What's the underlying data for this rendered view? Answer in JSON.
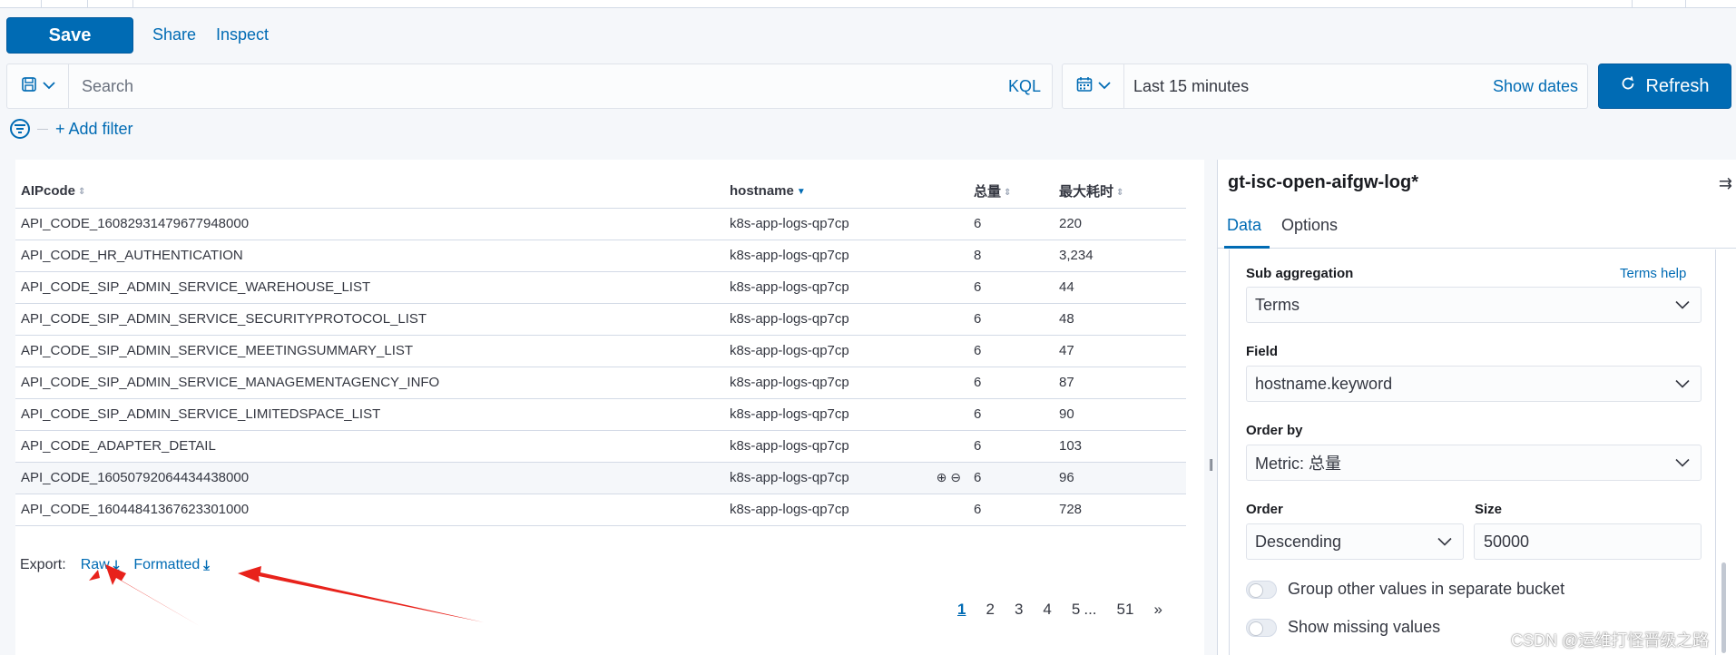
{
  "toolbar": {
    "save_label": "Save",
    "share_label": "Share",
    "inspect_label": "Inspect"
  },
  "query": {
    "placeholder": "Search",
    "language": "KQL"
  },
  "time": {
    "range": "Last 15 minutes",
    "show_dates_label": "Show dates",
    "refresh_label": "Refresh"
  },
  "filter": {
    "add_label": "+ Add filter"
  },
  "table": {
    "columns": [
      "AIPcode",
      "hostname",
      "总量",
      "最大耗时"
    ],
    "rows": [
      [
        "API_CODE_16082931479677948000",
        "k8s-app-logs-qp7cp",
        "6",
        "220"
      ],
      [
        "API_CODE_HR_AUTHENTICATION",
        "k8s-app-logs-qp7cp",
        "8",
        "3,234"
      ],
      [
        "API_CODE_SIP_ADMIN_SERVICE_WAREHOUSE_LIST",
        "k8s-app-logs-qp7cp",
        "6",
        "44"
      ],
      [
        "API_CODE_SIP_ADMIN_SERVICE_SECURITYPROTOCOL_LIST",
        "k8s-app-logs-qp7cp",
        "6",
        "48"
      ],
      [
        "API_CODE_SIP_ADMIN_SERVICE_MEETINGSUMMARY_LIST",
        "k8s-app-logs-qp7cp",
        "6",
        "47"
      ],
      [
        "API_CODE_SIP_ADMIN_SERVICE_MANAGEMENTAGENCY_INFO",
        "k8s-app-logs-qp7cp",
        "6",
        "87"
      ],
      [
        "API_CODE_SIP_ADMIN_SERVICE_LIMITEDSPACE_LIST",
        "k8s-app-logs-qp7cp",
        "6",
        "90"
      ],
      [
        "API_CODE_ADAPTER_DETAIL",
        "k8s-app-logs-qp7cp",
        "6",
        "103"
      ],
      [
        "API_CODE_16050792064434438000",
        "k8s-app-logs-qp7cp",
        "6",
        "96"
      ],
      [
        "API_CODE_16044841367623301000",
        "k8s-app-logs-qp7cp",
        "6",
        "728"
      ]
    ]
  },
  "export": {
    "label": "Export:",
    "raw_label": "Raw",
    "formatted_label": "Formatted"
  },
  "pagination": {
    "pages": [
      "1",
      "2",
      "3",
      "4",
      "5"
    ],
    "ellipsis": "...",
    "last": "51",
    "next": "»",
    "current": "1"
  },
  "sidebar": {
    "index_pattern": "gt-isc-open-aifgw-log*",
    "tabs": [
      "Data",
      "Options"
    ],
    "sub_aggregation_label": "Sub aggregation",
    "terms_help_label": "Terms help",
    "sub_aggregation_value": "Terms",
    "field_label": "Field",
    "field_value": "hostname.keyword",
    "order_by_label": "Order by",
    "order_by_value": "Metric: 总量",
    "order_label": "Order",
    "order_value": "Descending",
    "size_label": "Size",
    "size_value": "50000",
    "group_other_label": "Group other values in separate bucket",
    "show_missing_label": "Show missing values"
  },
  "watermark": "CSDN @运维打怪晋级之路",
  "colors": {
    "primary": "#006bb4",
    "annotation": "#e8221b"
  }
}
